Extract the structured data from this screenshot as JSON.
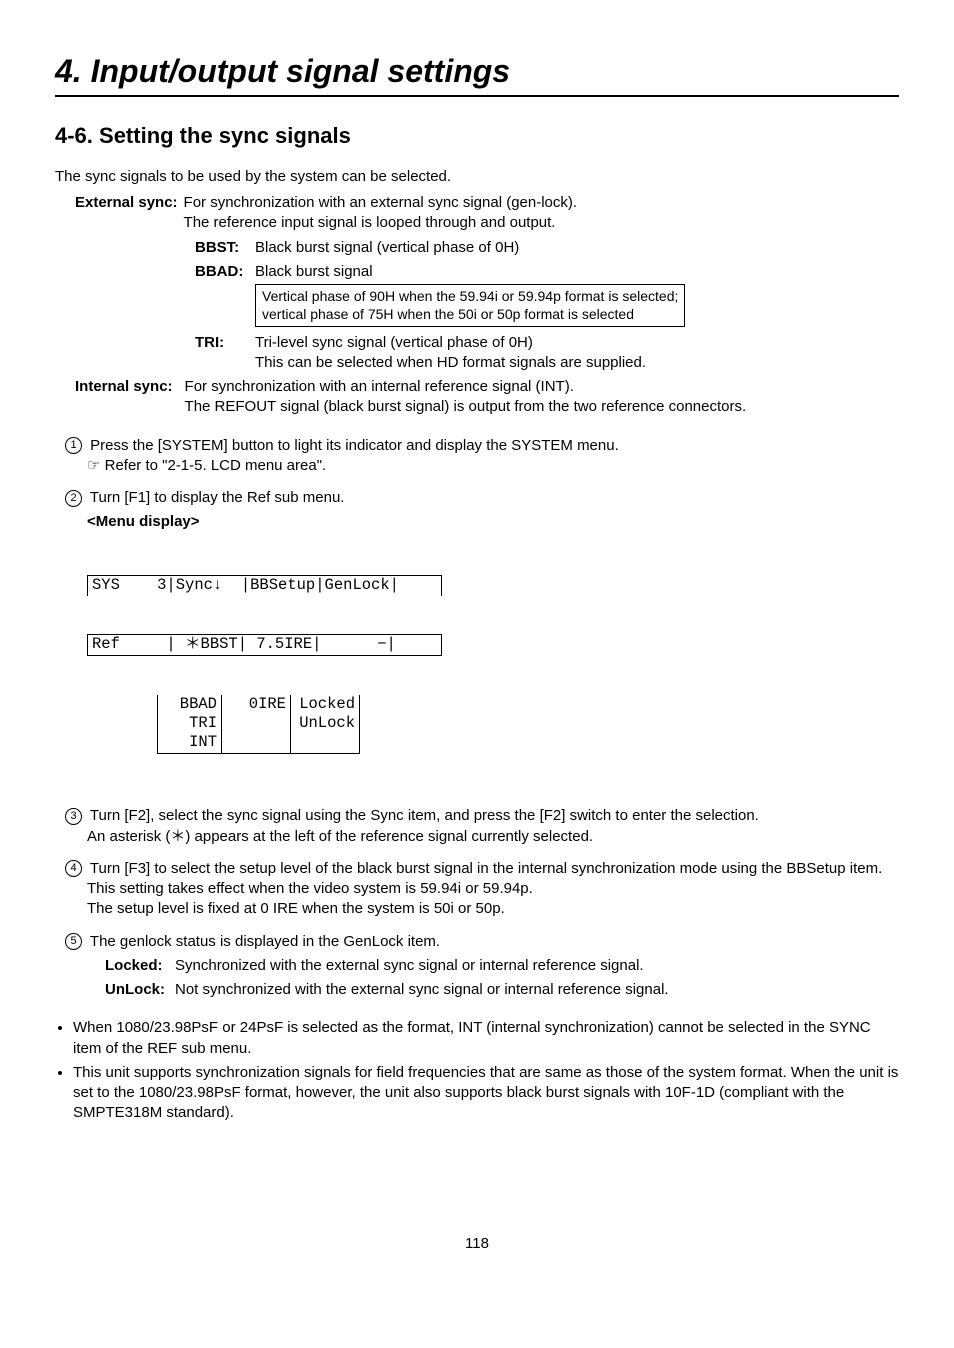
{
  "chapter": "4. Input/output signal settings",
  "section": "4-6. Setting the sync signals",
  "intro": "The sync signals to be used by the system can be selected.",
  "external": {
    "label": "External sync:",
    "desc1": "For synchronization with an external sync signal (gen-lock).",
    "desc2": "The reference input signal is looped through and output.",
    "bbst": {
      "label": "BBST:",
      "desc": "Black burst signal (vertical phase of 0H)"
    },
    "bbad": {
      "label": "BBAD:",
      "desc": "Black burst signal",
      "note1": "Vertical phase of 90H when the 59.94i or 59.94p format is selected;",
      "note2": "vertical phase of 75H when the 50i or 50p format is selected"
    },
    "tri": {
      "label": "TRI:",
      "desc1": "Tri-level sync signal (vertical phase of 0H)",
      "desc2": "This can be selected when HD format signals are supplied."
    }
  },
  "internal": {
    "label": "Internal sync:",
    "desc1": "For synchronization with an internal reference signal (INT).",
    "desc2": "The REFOUT signal (black burst signal) is output from the two reference connectors."
  },
  "steps": {
    "s1": {
      "text": "Press the [SYSTEM] button to light its indicator and display the SYSTEM menu.",
      "ref": "☞ Refer to \"2-1-5. LCD menu area\"."
    },
    "s2": {
      "text": "Turn [F1] to display the Ref sub menu."
    },
    "menu_title": "<Menu display>",
    "menu": {
      "row1": "SYS    3|Sync↓  |BBSetup|GenLock|",
      "row2": "Ref     | ＊BBST| 7.5IRE|      −|",
      "opts_c1": [
        "BBAD",
        "TRI",
        "INT"
      ],
      "opts_c2": [
        "0IRE"
      ],
      "opts_c3": [
        "Locked",
        "UnLock"
      ]
    },
    "s3": {
      "line1": "Turn [F2], select the sync signal using the Sync item, and press the [F2] switch to enter the selection.",
      "line2": "An asterisk (＊) appears at the left of the reference signal currently selected."
    },
    "s4": {
      "line1": "Turn [F3] to select the setup level of the black burst signal in the internal synchronization mode using the BBSetup item.",
      "line2": "This setting takes effect when the video system is 59.94i or 59.94p.",
      "line3": "The setup level is fixed at 0 IRE when the system is 50i or 50p."
    },
    "s5": {
      "text": "The genlock status is displayed in the GenLock item.",
      "locked": {
        "label": "Locked:",
        "desc": "Synchronized with the external sync signal or internal reference signal."
      },
      "unlock": {
        "label": "UnLock:",
        "desc": "Not synchronized with the external sync signal or internal reference signal."
      }
    }
  },
  "bullets": {
    "b1": "When 1080/23.98PsF or 24PsF is selected as the format, INT (internal synchronization) cannot be selected in the SYNC item of the REF sub menu.",
    "b2": "This unit supports synchronization signals for field frequencies that are same as those of the system format. When the unit is set to the 1080/23.98PsF format, however, the unit also supports black burst signals with 10F-1D (compliant with the SMPTE318M standard)."
  },
  "page": "118"
}
